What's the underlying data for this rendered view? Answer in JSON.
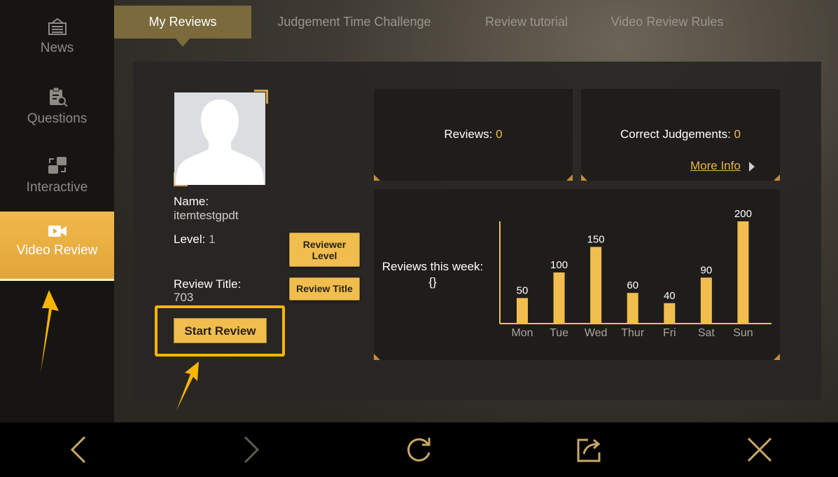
{
  "sidebar": {
    "items": [
      {
        "label": "News",
        "icon": "news-icon"
      },
      {
        "label": "Questions",
        "icon": "questions-icon"
      },
      {
        "label": "Interactive",
        "icon": "interactive-icon"
      },
      {
        "label": "Video Review",
        "icon": "video-camera-icon",
        "active": true
      }
    ]
  },
  "tabs": [
    {
      "label": "My Reviews",
      "active": true
    },
    {
      "label": "Judgement Time Challenge"
    },
    {
      "label": "Review tutorial"
    },
    {
      "label": "Video Review Rules"
    }
  ],
  "profile": {
    "name_label": "Name:",
    "name_value": "itemtestgpdt",
    "level_label": "Level:",
    "level_value": "1",
    "title_label": "Review Title:",
    "title_value": "703",
    "reviewer_level_button": "Reviewer Level",
    "review_title_button": "Review Title",
    "start_button": "Start Review"
  },
  "stats": {
    "reviews_label": "Reviews:",
    "reviews_value": "0",
    "correct_label": "Correct Judgements:",
    "correct_value": "0",
    "more_info": "More Info",
    "week_label": "Reviews this week:",
    "week_value": "{}"
  },
  "chart_data": {
    "type": "bar",
    "categories": [
      "Mon",
      "Tue",
      "Wed",
      "Thur",
      "Fri",
      "Sat",
      "Sun"
    ],
    "values": [
      50,
      100,
      150,
      60,
      40,
      90,
      200
    ],
    "ylim": [
      0,
      200
    ],
    "bar_color": "#f0bd4e",
    "axis_color": "#f0bd4e"
  },
  "colors": {
    "accent": "#f0bd4e",
    "highlight": "#f7b500"
  }
}
